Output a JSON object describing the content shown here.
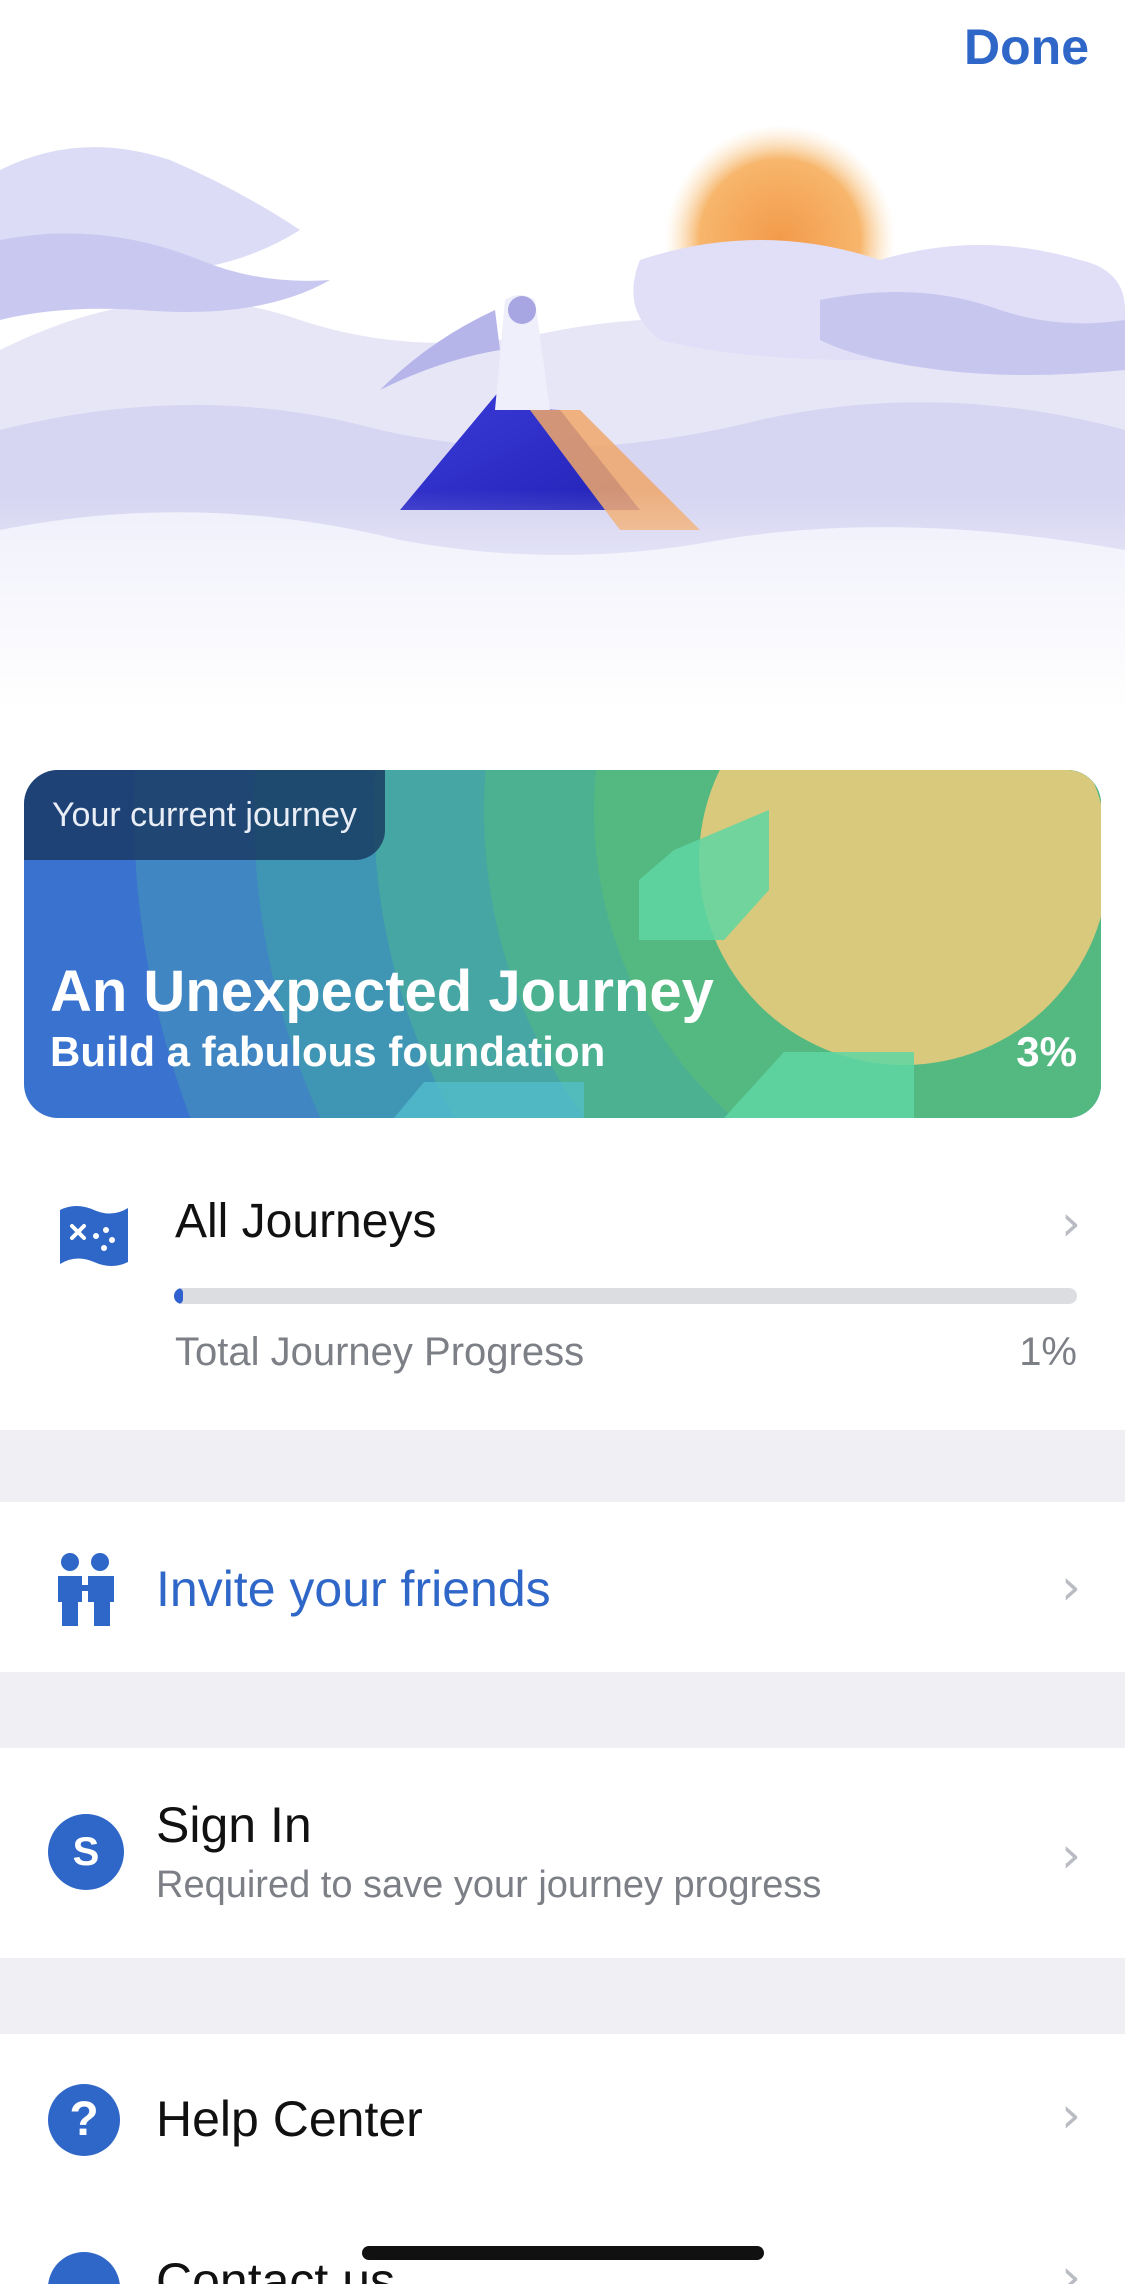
{
  "header": {
    "done_label": "Done"
  },
  "current_journey": {
    "tag": "Your current journey",
    "title": "An Unexpected Journey",
    "subtitle": "Build a fabulous foundation",
    "progress_label": "3%"
  },
  "all_journeys": {
    "title": "All Journeys",
    "progress_caption": "Total Journey Progress",
    "progress_label": "1%",
    "progress_fraction": 0.01
  },
  "invite": {
    "label": "Invite your friends"
  },
  "sign_in": {
    "avatar_letter": "S",
    "title": "Sign In",
    "subtitle": "Required to save your journey progress"
  },
  "help": {
    "icon_glyph": "?",
    "label": "Help Center"
  },
  "contact": {
    "label": "Contact us"
  },
  "colors": {
    "accent": "#2f67c8",
    "separator": "#efeff4",
    "secondary_text": "#7c7f85"
  },
  "icons": {
    "chevron": "chevron-right-icon",
    "all_journeys": "map-icon",
    "invite": "people-icon",
    "help": "question-icon",
    "contact": "chat-icon"
  }
}
